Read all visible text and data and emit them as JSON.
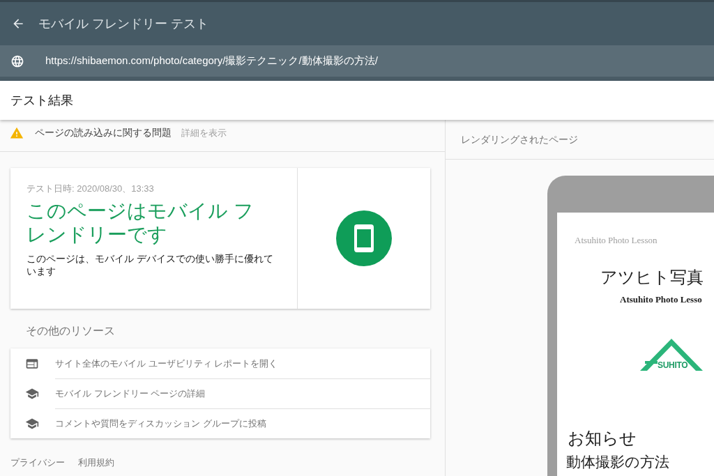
{
  "app_bar": {
    "title": "モバイル フレンドリー テスト"
  },
  "url_bar": {
    "url": "https://shibaemon.com/photo/category/撮影テクニック/動体撮影の方法/"
  },
  "section_header": {
    "title": "テスト結果"
  },
  "warning": {
    "text": "ページの読み込みに関する問題",
    "link": "詳細を表示"
  },
  "result_card": {
    "timestamp": "テスト日時: 2020/08/30、13:33",
    "headline": "このページはモバイル フレンドリーです",
    "description": "このページは、モバイル デバイスでの使い勝手に優れています",
    "mobile_friendly": true
  },
  "resources": {
    "title": "その他のリソース",
    "items": [
      {
        "kind": "report",
        "label": "サイト全体のモバイル ユーザビリティ レポートを開く"
      },
      {
        "kind": "learn",
        "label": "モバイル フレンドリー ページの詳細"
      },
      {
        "kind": "learn",
        "label": "コメントや質問をディスカッション グループに投稿"
      }
    ]
  },
  "footer_links": [
    "プライバシー",
    "利用規約"
  ],
  "rendered_page": {
    "title": "レンダリングされたページ",
    "preview": {
      "site_name": "Atsuhito Photo Lesson",
      "heading": "アツヒト写真",
      "subheading": "Atsuhito Photo Lesso",
      "logo_text": "SUHITO",
      "section_title": "お知らせ",
      "post_title": "動体撮影の方法"
    }
  }
}
